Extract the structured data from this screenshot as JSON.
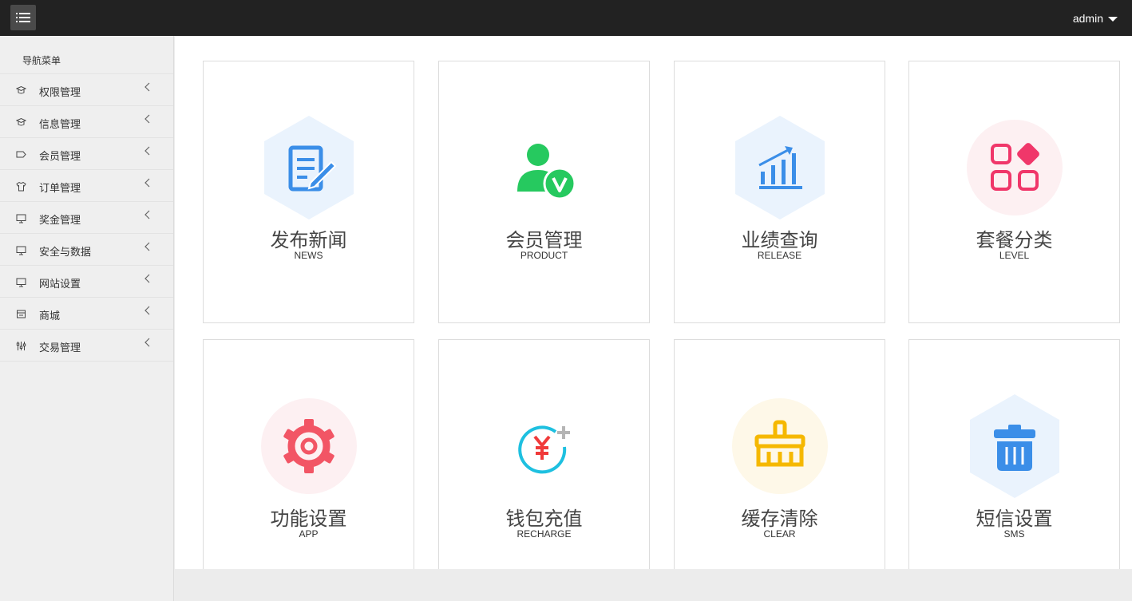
{
  "header": {
    "menu_toggle_icon": "list-icon",
    "user": "admin"
  },
  "sidebar": {
    "title": "导航菜单",
    "items": [
      {
        "label": "权限管理",
        "icon": "graduation-cap-icon"
      },
      {
        "label": "信息管理",
        "icon": "graduation-cap-icon"
      },
      {
        "label": "会员管理",
        "icon": "tag-icon"
      },
      {
        "label": "订单管理",
        "icon": "shirt-icon"
      },
      {
        "label": "奖金管理",
        "icon": "monitor-icon"
      },
      {
        "label": "安全与数据",
        "icon": "monitor-icon"
      },
      {
        "label": "网站设置",
        "icon": "monitor-icon"
      },
      {
        "label": "商城",
        "icon": "wallet-icon"
      },
      {
        "label": "交易管理",
        "icon": "sliders-icon"
      }
    ]
  },
  "cards": [
    {
      "title": "发布新闻",
      "subtitle": "NEWS",
      "icon": "edit-document-icon",
      "color": "#3b8ee8"
    },
    {
      "title": "会员管理",
      "subtitle": "PRODUCT",
      "icon": "user-verified-icon",
      "color": "#26c95f"
    },
    {
      "title": "业绩查询",
      "subtitle": "RELEASE",
      "icon": "bar-chart-icon",
      "color": "#3b8ee8"
    },
    {
      "title": "套餐分类",
      "subtitle": "LEVEL",
      "icon": "category-icon",
      "color": "#f0376a"
    },
    {
      "title": "功能设置",
      "subtitle": "APP",
      "icon": "gear-icon",
      "color": "#f25565"
    },
    {
      "title": "钱包充值",
      "subtitle": "RECHARGE",
      "icon": "recharge-icon",
      "color": "#f03a3a"
    },
    {
      "title": "缓存清除",
      "subtitle": "CLEAR",
      "icon": "broom-icon",
      "color": "#f5b800"
    },
    {
      "title": "短信设置",
      "subtitle": "SMS",
      "icon": "trash-icon",
      "color": "#3b8ee8"
    }
  ]
}
